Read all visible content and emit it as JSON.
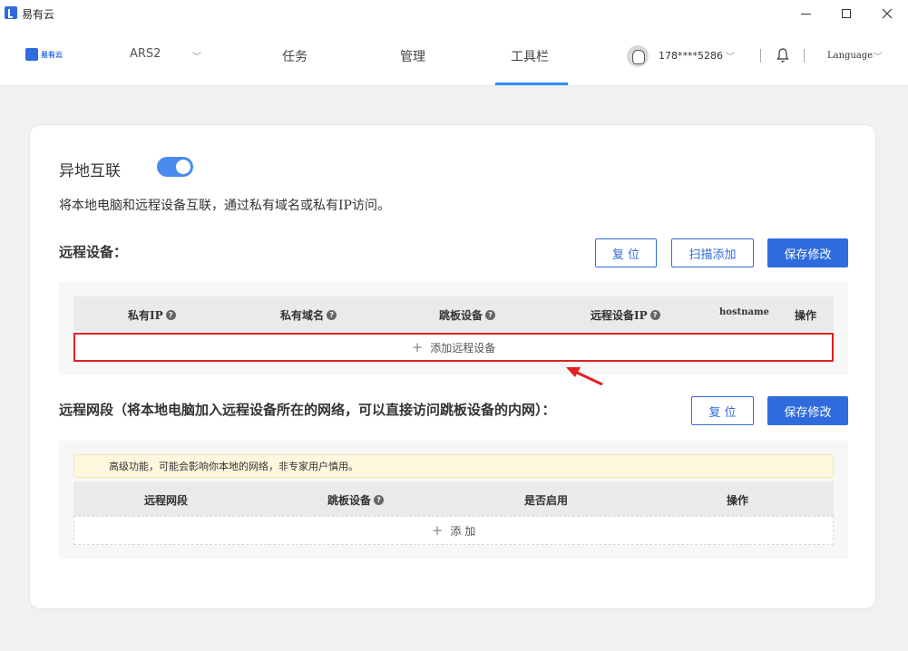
{
  "window": {
    "app_title": "易有云"
  },
  "nav": {
    "brand": "易有云",
    "device": "ARS2",
    "tabs": [
      "任务",
      "管理",
      "工具栏"
    ],
    "user_phone": "178****5286",
    "language": "Language"
  },
  "feature": {
    "title": "异地互联",
    "enabled": true,
    "description": "将本地电脑和远程设备互联，通过私有域名或私有IP访问。"
  },
  "remote_devices": {
    "title": "远程设备：",
    "buttons": {
      "reset": "复 位",
      "scan_add": "扫描添加",
      "save": "保存修改"
    },
    "columns": [
      "私有IP",
      "私有域名",
      "跳板设备",
      "远程设备IP",
      "hostname",
      "操作"
    ],
    "add_label": "添加远程设备"
  },
  "remote_segments": {
    "title": "远程网段（将本地电脑加入远程设备所在的网络，可以直接访问跳板设备的内网）：",
    "buttons": {
      "reset": "复 位",
      "save": "保存修改"
    },
    "warning": "高级功能，可能会影响你本地的网络，非专家用户慎用。",
    "columns": [
      "远程网段",
      "跳板设备",
      "是否启用",
      "操作"
    ],
    "add_label": "添 加"
  },
  "colors": {
    "accent": "#2f6bdc",
    "highlight": "#e02020",
    "warning_bg": "#fdf8dd"
  }
}
